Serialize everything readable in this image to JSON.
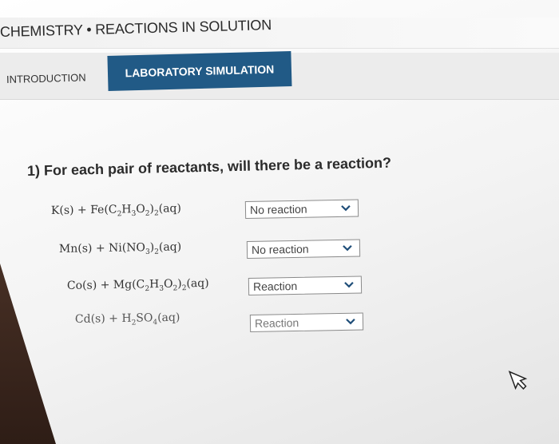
{
  "header": {
    "title": "CHEMISTRY • REACTIONS IN SOLUTION"
  },
  "tabs": [
    {
      "label": "INTRODUCTION",
      "active": false
    },
    {
      "label": "LABORATORY SIMULATION",
      "active": true
    }
  ],
  "question": "1) For each pair of reactants, will there be a reaction?",
  "rows": [
    {
      "reactant": [
        "K(s) + Fe(C",
        "2",
        "H",
        "3",
        "O",
        "2",
        ")",
        "2",
        "(aq)"
      ],
      "selected": "No reaction"
    },
    {
      "reactant": [
        "Mn(s) + Ni(NO",
        "3",
        ")",
        "2",
        "(aq)"
      ],
      "selected": "No reaction"
    },
    {
      "reactant": [
        "Co(s) + Mg(C",
        "2",
        "H",
        "3",
        "O",
        "2",
        ")",
        "2",
        "(aq)"
      ],
      "selected": "Reaction"
    },
    {
      "reactant": [
        "Cd(s) + H",
        "2",
        "SO",
        "4",
        "(aq)"
      ],
      "selected": "Reaction"
    }
  ],
  "colors": {
    "active_tab": "#215a86",
    "page_bg": "#f3f3f3"
  }
}
